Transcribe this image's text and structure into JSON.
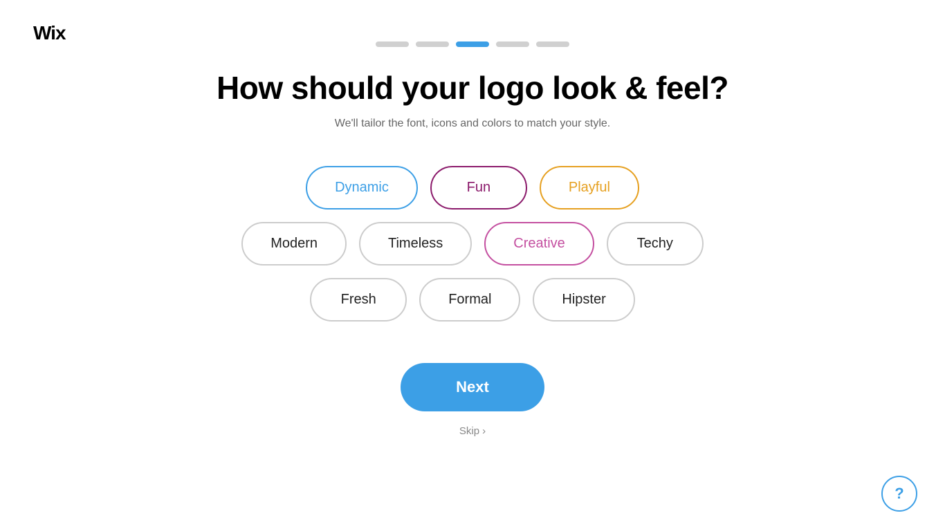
{
  "logo": {
    "text": "Wix"
  },
  "progress": {
    "steps": [
      {
        "id": 1,
        "active": false
      },
      {
        "id": 2,
        "active": false
      },
      {
        "id": 3,
        "active": true
      },
      {
        "id": 4,
        "active": false
      },
      {
        "id": 5,
        "active": false
      }
    ]
  },
  "page": {
    "title": "How should your logo look & feel?",
    "subtitle": "We'll tailor the font, icons and colors to match your style."
  },
  "options": {
    "row1": [
      {
        "id": "dynamic",
        "label": "Dynamic",
        "style": "dynamic"
      },
      {
        "id": "fun",
        "label": "Fun",
        "style": "fun"
      },
      {
        "id": "playful",
        "label": "Playful",
        "style": "playful"
      }
    ],
    "row2": [
      {
        "id": "modern",
        "label": "Modern",
        "style": "modern"
      },
      {
        "id": "timeless",
        "label": "Timeless",
        "style": "timeless"
      },
      {
        "id": "creative",
        "label": "Creative",
        "style": "creative"
      },
      {
        "id": "techy",
        "label": "Techy",
        "style": "techy"
      }
    ],
    "row3": [
      {
        "id": "fresh",
        "label": "Fresh",
        "style": "fresh"
      },
      {
        "id": "formal",
        "label": "Formal",
        "style": "formal"
      },
      {
        "id": "hipster",
        "label": "Hipster",
        "style": "hipster"
      }
    ]
  },
  "actions": {
    "next_label": "Next",
    "skip_label": "Skip",
    "skip_chevron": "›"
  },
  "help": {
    "label": "?"
  }
}
